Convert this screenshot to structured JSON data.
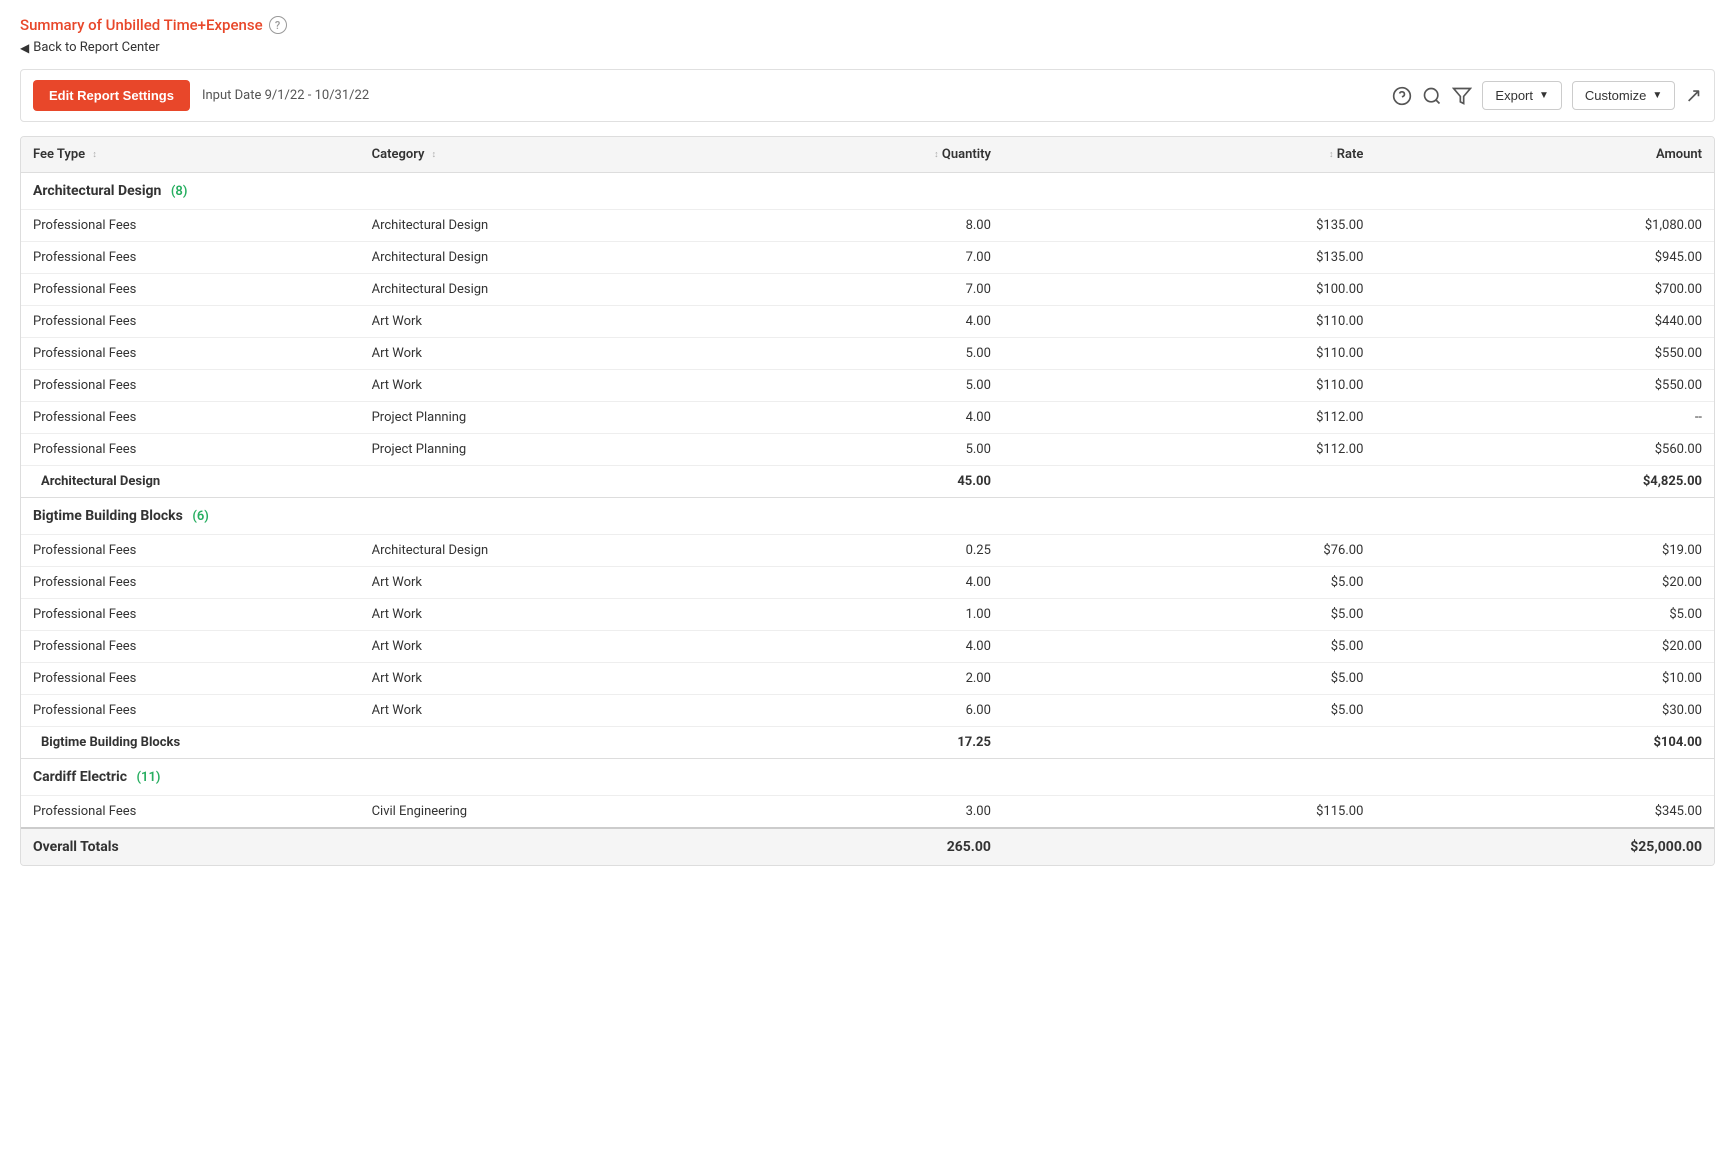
{
  "page": {
    "title": "Summary of Unbilled Time+Expense",
    "back_label": "Back to Report Center",
    "date_range_label": "Input Date 9/1/22 - 10/31/22"
  },
  "toolbar": {
    "edit_btn_label": "Edit Report Settings",
    "export_label": "Export",
    "customize_label": "Customize"
  },
  "table": {
    "columns": [
      {
        "id": "fee_type",
        "label": "Fee Type"
      },
      {
        "id": "category",
        "label": "Category"
      },
      {
        "id": "quantity",
        "label": "Quantity"
      },
      {
        "id": "rate",
        "label": "Rate"
      },
      {
        "id": "amount",
        "label": "Amount"
      }
    ],
    "groups": [
      {
        "name": "Architectural Design",
        "count": 8,
        "rows": [
          {
            "fee_type": "Professional Fees",
            "category": "Architectural Design",
            "quantity": "8.00",
            "rate": "$135.00",
            "amount": "$1,080.00"
          },
          {
            "fee_type": "Professional Fees",
            "category": "Architectural Design",
            "quantity": "7.00",
            "rate": "$135.00",
            "amount": "$945.00"
          },
          {
            "fee_type": "Professional Fees",
            "category": "Architectural Design",
            "quantity": "7.00",
            "rate": "$100.00",
            "amount": "$700.00"
          },
          {
            "fee_type": "Professional Fees",
            "category": "Art Work",
            "quantity": "4.00",
            "rate": "$110.00",
            "amount": "$440.00"
          },
          {
            "fee_type": "Professional Fees",
            "category": "Art Work",
            "quantity": "5.00",
            "rate": "$110.00",
            "amount": "$550.00"
          },
          {
            "fee_type": "Professional Fees",
            "category": "Art Work",
            "quantity": "5.00",
            "rate": "$110.00",
            "amount": "$550.00"
          },
          {
            "fee_type": "Professional Fees",
            "category": "Project Planning",
            "quantity": "4.00",
            "rate": "$112.00",
            "amount": "--"
          },
          {
            "fee_type": "Professional Fees",
            "category": "Project Planning",
            "quantity": "5.00",
            "rate": "$112.00",
            "amount": "$560.00"
          }
        ],
        "subtotal_label": "Architectural Design",
        "subtotal_quantity": "45.00",
        "subtotal_amount": "$4,825.00"
      },
      {
        "name": "Bigtime Building Blocks",
        "count": 6,
        "rows": [
          {
            "fee_type": "Professional Fees",
            "category": "Architectural Design",
            "quantity": "0.25",
            "rate": "$76.00",
            "amount": "$19.00"
          },
          {
            "fee_type": "Professional Fees",
            "category": "Art Work",
            "quantity": "4.00",
            "rate": "$5.00",
            "amount": "$20.00"
          },
          {
            "fee_type": "Professional Fees",
            "category": "Art Work",
            "quantity": "1.00",
            "rate": "$5.00",
            "amount": "$5.00"
          },
          {
            "fee_type": "Professional Fees",
            "category": "Art Work",
            "quantity": "4.00",
            "rate": "$5.00",
            "amount": "$20.00"
          },
          {
            "fee_type": "Professional Fees",
            "category": "Art Work",
            "quantity": "2.00",
            "rate": "$5.00",
            "amount": "$10.00"
          },
          {
            "fee_type": "Professional Fees",
            "category": "Art Work",
            "quantity": "6.00",
            "rate": "$5.00",
            "amount": "$30.00"
          }
        ],
        "subtotal_label": "Bigtime Building Blocks",
        "subtotal_quantity": "17.25",
        "subtotal_amount": "$104.00"
      },
      {
        "name": "Cardiff Electric",
        "count": 11,
        "rows": [
          {
            "fee_type": "Professional Fees",
            "category": "Civil Engineering",
            "quantity": "3.00",
            "rate": "$115.00",
            "amount": "$345.00"
          }
        ],
        "subtotal_label": null,
        "subtotal_quantity": null,
        "subtotal_amount": null,
        "partial": true
      }
    ],
    "overall_totals": {
      "label": "Overall Totals",
      "quantity": "265.00",
      "amount": "$25,000.00"
    }
  }
}
